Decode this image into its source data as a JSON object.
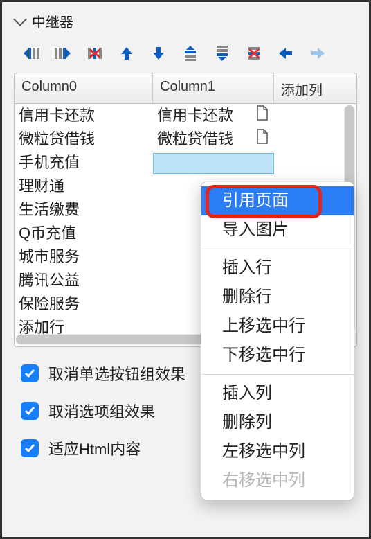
{
  "panel": {
    "title": "中继器"
  },
  "columns": {
    "c0": "Column0",
    "c1": "Column1",
    "c2": "添加列"
  },
  "rows": [
    {
      "c0": "信用卡还款",
      "c1": "信用卡还款",
      "hasRef": true
    },
    {
      "c0": "微粒贷借钱",
      "c1": "微粒贷借钱",
      "hasRef": true
    },
    {
      "c0": "手机充值",
      "c1": "",
      "selected": true
    },
    {
      "c0": "理财通",
      "c1": ""
    },
    {
      "c0": "生活缴费",
      "c1": ""
    },
    {
      "c0": "Q币充值",
      "c1": ""
    },
    {
      "c0": "城市服务",
      "c1": ""
    },
    {
      "c0": "腾讯公益",
      "c1": ""
    },
    {
      "c0": "保险服务",
      "c1": ""
    },
    {
      "c0": "添加行",
      "c1": ""
    }
  ],
  "opts": {
    "o1": "取消单选按钮组效果",
    "o2": "取消选项组效果",
    "o3": "适应Html内容"
  },
  "ctx": {
    "refPage": "引用页面",
    "importImg": "导入图片",
    "insRow": "插入行",
    "delRow": "删除行",
    "moveRowUp": "上移选中行",
    "moveRowDown": "下移选中行",
    "insCol": "插入列",
    "delCol": "删除列",
    "moveColLeft": "左移选中列",
    "moveColRight": "右移选中列"
  }
}
